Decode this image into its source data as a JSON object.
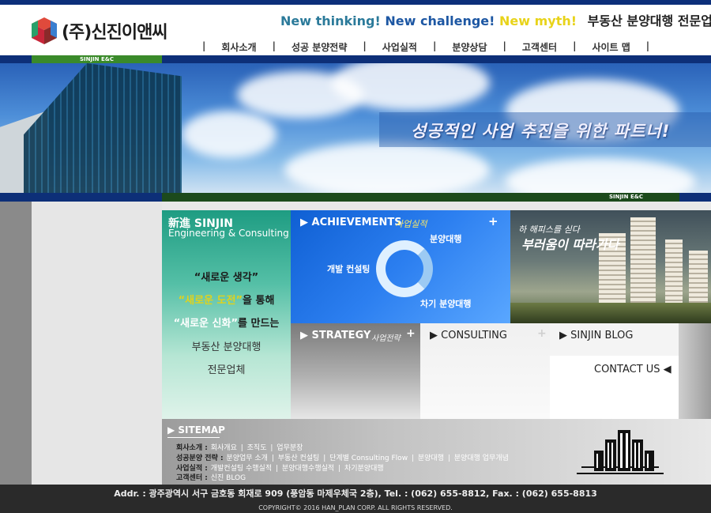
{
  "header": {
    "logo_text": "(주)신진이앤씨",
    "slogan_parts": [
      "New thinking!",
      "New challenge!",
      "New myth!"
    ],
    "slogan_tag": "부동산 분양대행 전문업체",
    "nav": [
      "회사소개",
      "성공 분양전략",
      "사업실적",
      "분양상담",
      "고객센터",
      "사이트 맵"
    ],
    "sub_brand": "SINJIN E&C"
  },
  "hero": {
    "slogan": "성공적인 사업 추진을 위한 파트너!",
    "band_label": "SINJIN E&C"
  },
  "intro": {
    "title": "新進 SINJIN",
    "subtitle": "Engineering & Consulting",
    "line1": "“새로운 생각”",
    "line2a": "“새로운 도전”",
    "line2b": "을 통해",
    "line3a": "“새로운 신화”",
    "line3b": "를 만드는",
    "line4": "부동산 분양대행",
    "line5": "전문업체"
  },
  "achievements": {
    "label": "▶ ACHIEVEMENTS",
    "sub": "사업실적",
    "plus": "+",
    "cycle": [
      "분양대행",
      "개발 컨설팅",
      "차기 분양대행"
    ]
  },
  "promo": {
    "text1": "하 해피스를 싣다",
    "text2": "부러움이 따라가다"
  },
  "boxes": {
    "strategy_label": "▶ STRATEGY",
    "strategy_sub": "사업전략",
    "consulting_label": "▶ CONSULTING",
    "blog_label": "▶ SINJIN BLOG",
    "contact_label": "CONTACT US ◀",
    "plus": "+"
  },
  "sitemap": {
    "title": "▶ SITEMAP",
    "rows": [
      {
        "head": "회사소개 :",
        "items": [
          "회사개요",
          "조직도",
          "업무분장"
        ]
      },
      {
        "head": "성공분양 전략 :",
        "items": [
          "분양업무 소개",
          "부동산 컨설팅",
          "단계별 Consulting Flow",
          "분양대행",
          "분양대행 업무개념"
        ]
      },
      {
        "head": "사업실적 :",
        "items": [
          "개발컨설팅 수행실적",
          "분양대행수행실적",
          "차기분양대행"
        ]
      },
      {
        "head": "고객센터 :",
        "items": [
          "신진 BLOG"
        ]
      }
    ],
    "sep": "|"
  },
  "footer": {
    "address": "Addr. : 광주광역시 서구 금호동 회재로 909 (풍암동 마제우체국 2층), Tel. : (062) 655-8812, Fax. : (062) 655-8813",
    "copyright": "COPYRIGHT© 2016 HAN_PLAN CORP. ALL RIGHTS RESERVED."
  },
  "colors": {
    "navy": "#0d2f78",
    "green": "#3a8a2a",
    "teal": "#1e9c82",
    "blue": "#1e6fe0"
  }
}
